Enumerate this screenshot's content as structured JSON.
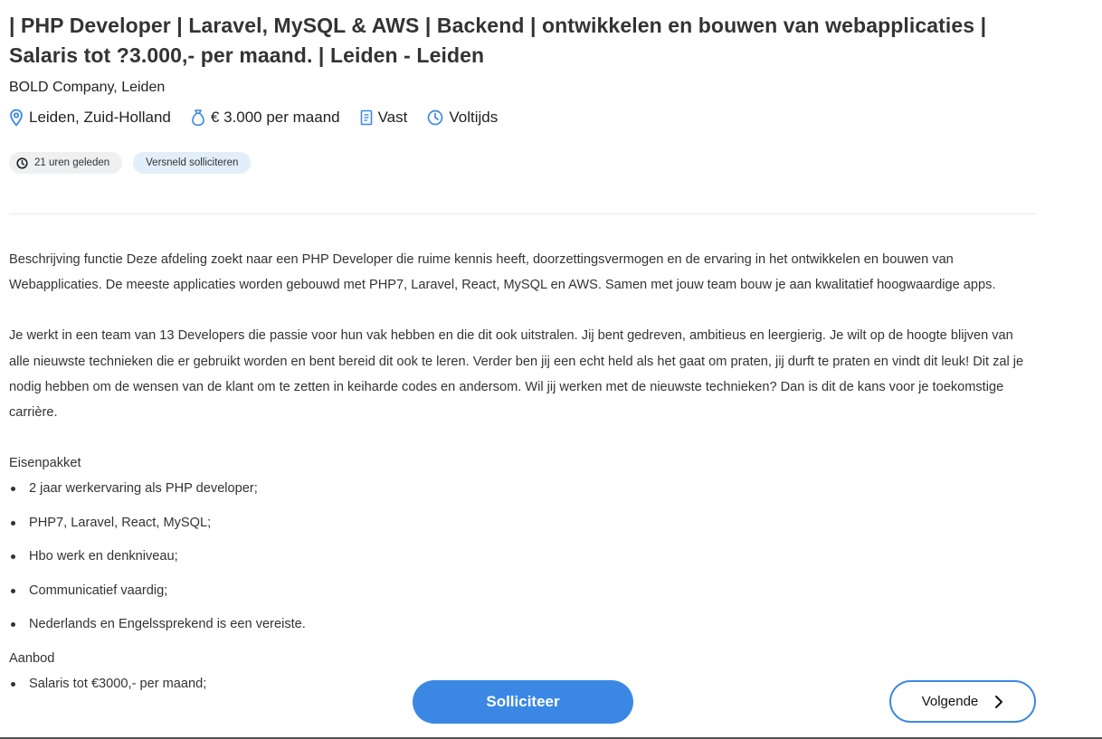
{
  "job": {
    "title": "| PHP Developer | Laravel, MySQL & AWS | Backend | ontwikkelen en bouwen van webapplicaties | Salaris tot ?3.000,- per maand. | Leiden - Leiden",
    "company": "BOLD Company, Leiden",
    "meta": {
      "location": "Leiden, Zuid-Holland",
      "salary": "€ 3.000 per maand",
      "contract": "Vast",
      "hours": "Voltijds"
    },
    "tags": {
      "posted": "21 uren geleden",
      "quick_apply": "Versneld solliciteren"
    },
    "description": {
      "paragraph1": "Beschrijving functie Deze afdeling zoekt naar een PHP Developer die ruime kennis heeft, doorzettingsvermogen en de ervaring in het ontwikkelen en bouwen van Webapplicaties. De meeste applicaties worden gebouwd met PHP7, Laravel, React, MySQL en AWS. Samen met jouw team bouw je aan kwalitatief hoogwaardige apps.",
      "paragraph2": "Je werkt in een team van 13 Developers die passie voor hun vak hebben en die dit ook uitstralen. Jij bent gedreven, ambitieus en leergierig. Je wilt op de hoogte blijven van alle nieuwste technieken die er gebruikt worden en bent bereid dit ook te leren. Verder ben jij een echt held als het gaat om praten, jij durft te praten en vindt dit leuk! Dit zal je nodig hebben om de wensen van de klant om te zetten in keiharde codes en andersom. Wil jij werken met de nieuwste technieken? Dan is dit de kans voor je toekomstige carrière.",
      "requirements_title": "Eisenpakket",
      "requirements": [
        "2 jaar werkervaring als PHP developer;",
        "PHP7, Laravel, React, MySQL;",
        "Hbo werk en denkniveau;",
        "Communicatief vaardig;",
        "Nederlands en Engelssprekend is een vereiste."
      ],
      "offer_title": "Aanbod",
      "offer": [
        "Salaris tot €3000,- per maand;"
      ]
    }
  },
  "actions": {
    "apply_label": "Solliciteer",
    "next_label": "Volgende"
  },
  "colors": {
    "accent": "#3b88e4",
    "tag_gray": "#eef0f2",
    "tag_blue": "#e3eefb"
  },
  "icons": {
    "location": "map-pin-icon",
    "salary": "money-bag-icon",
    "contract": "document-icon",
    "hours": "clock-icon",
    "posted": "clock-small-icon",
    "next": "chevron-right-icon"
  }
}
